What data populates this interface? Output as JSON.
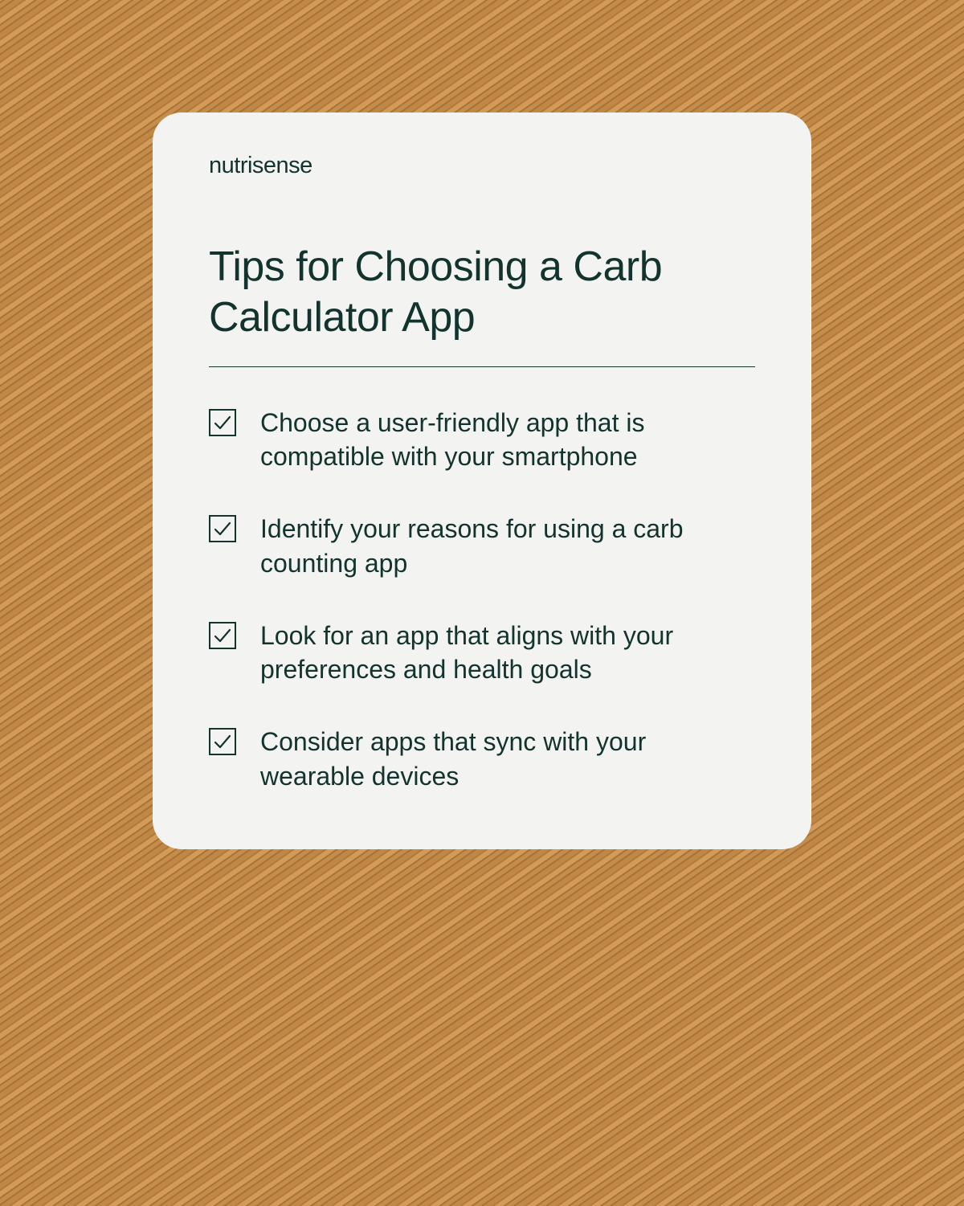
{
  "brand": "nutrisense",
  "title": "Tips for Choosing a Carb Calculator App",
  "items": [
    {
      "text": "Choose a user-friendly app that is compatible with your smartphone"
    },
    {
      "text": "Identify your reasons for using a carb counting app"
    },
    {
      "text": "Look for an app that aligns with your preferences and health goals"
    },
    {
      "text": "Consider apps that sync with your wearable devices"
    }
  ]
}
